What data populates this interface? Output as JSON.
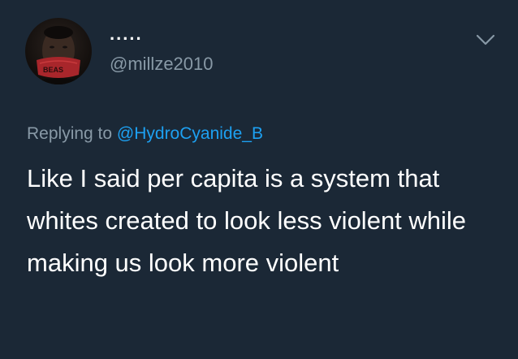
{
  "tweet": {
    "display_name": ".....",
    "handle": "@millze2010",
    "replying_prefix": "Replying to ",
    "replying_to": "@HydroCyanide_B",
    "text": "Like I said per capita is a system that whites created to look less violent while making us look more violent",
    "avatar_text": "BEAS"
  },
  "icons": {
    "menu": "chevron-down-icon"
  },
  "colors": {
    "background": "#1b2836",
    "secondary_text": "#8899a6",
    "link": "#1da1f2",
    "primary_text": "#ffffff"
  }
}
